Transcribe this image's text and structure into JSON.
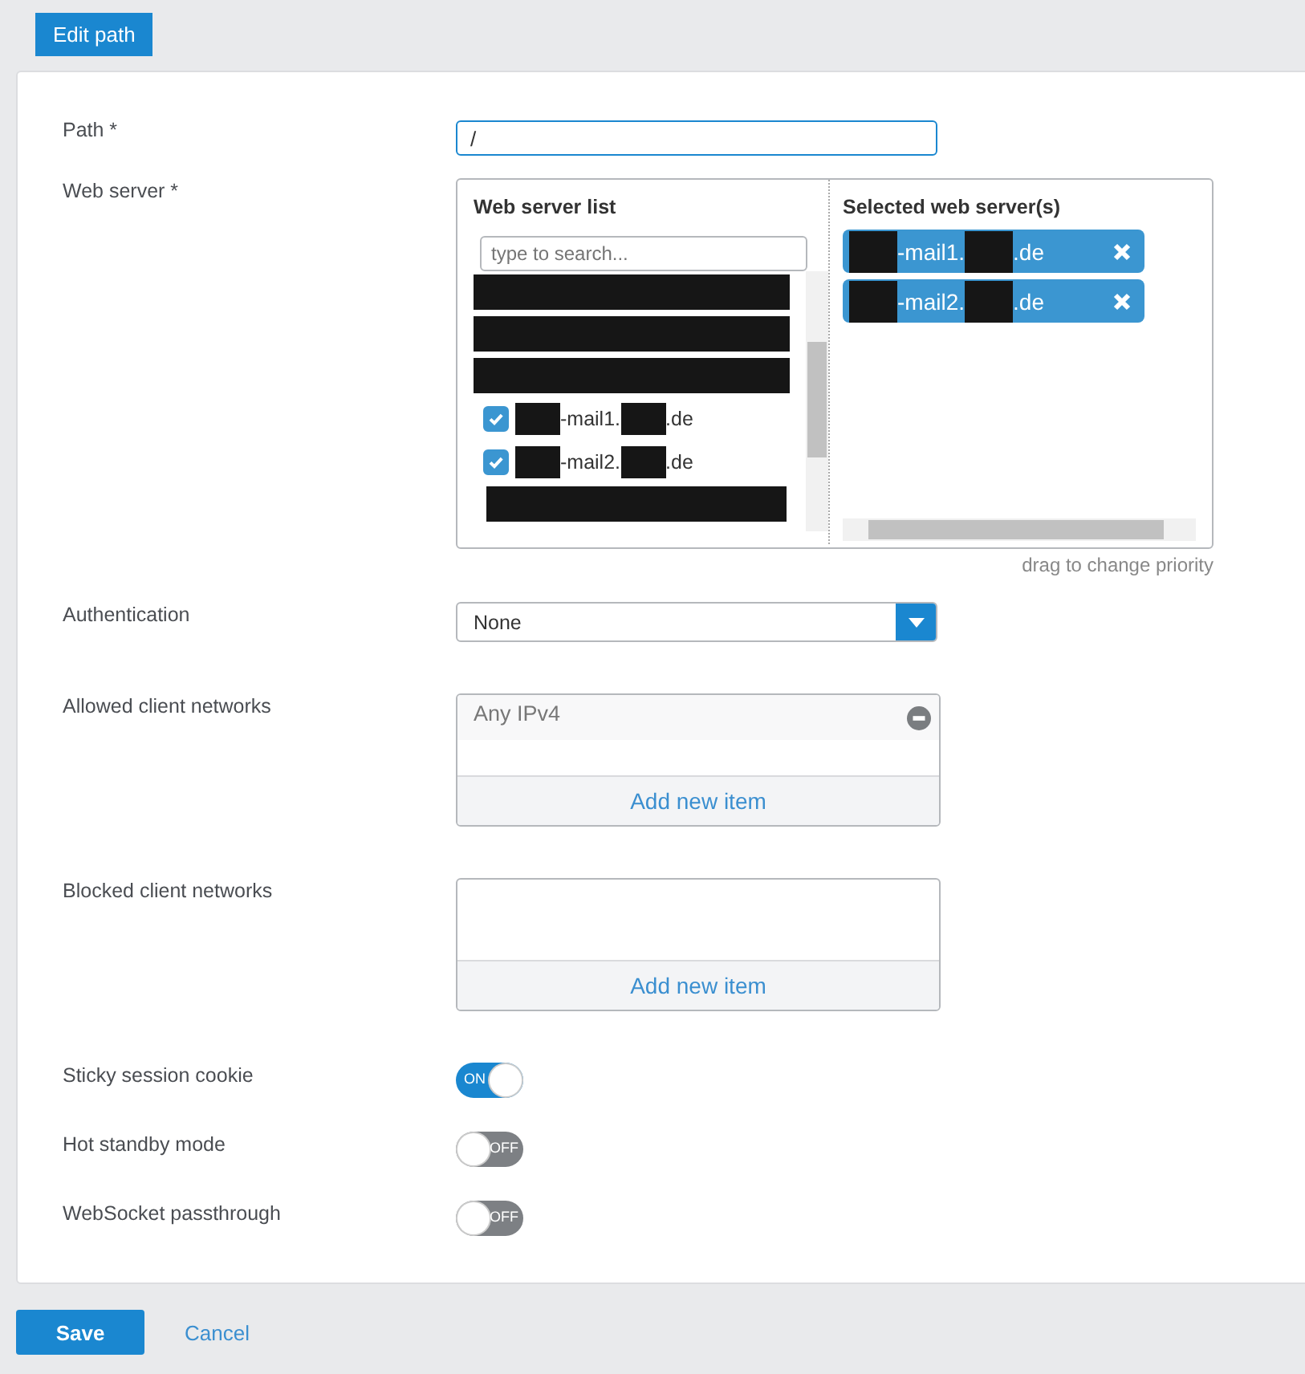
{
  "header_button": "Edit path",
  "path": {
    "label": "Path *",
    "value": "/"
  },
  "web_server": {
    "label": "Web server *",
    "list_title": "Web server list",
    "search_placeholder": "type to search...",
    "selected_title": "Selected web server(s)",
    "hint": "drag to change priority",
    "items": [
      {
        "kind": "redaction"
      },
      {
        "kind": "redaction"
      },
      {
        "kind": "redaction"
      },
      {
        "kind": "server",
        "checked": true,
        "segments": [
          {
            "kind": "redaction"
          },
          {
            "kind": "text",
            "text": "-mail1."
          },
          {
            "kind": "redaction"
          },
          {
            "kind": "text",
            "text": ".de"
          }
        ]
      },
      {
        "kind": "server",
        "checked": true,
        "segments": [
          {
            "kind": "redaction"
          },
          {
            "kind": "text",
            "text": "-mail2."
          },
          {
            "kind": "redaction"
          },
          {
            "kind": "text",
            "text": ".de"
          }
        ]
      },
      {
        "kind": "redaction"
      }
    ],
    "selected": [
      {
        "segments": [
          {
            "kind": "redaction"
          },
          {
            "kind": "text",
            "text": "-mail1."
          },
          {
            "kind": "redaction"
          },
          {
            "kind": "text",
            "text": ".de"
          }
        ]
      },
      {
        "segments": [
          {
            "kind": "redaction"
          },
          {
            "kind": "text",
            "text": "-mail2."
          },
          {
            "kind": "redaction"
          },
          {
            "kind": "text",
            "text": ".de"
          }
        ]
      }
    ]
  },
  "authentication": {
    "label": "Authentication",
    "value": "None"
  },
  "allowed_networks": {
    "label": "Allowed client networks",
    "items": [
      "Any IPv4"
    ],
    "add": "Add new item"
  },
  "blocked_networks": {
    "label": "Blocked client networks",
    "add": "Add new item"
  },
  "toggles": [
    {
      "label": "Sticky session cookie",
      "on": true,
      "text": "ON"
    },
    {
      "label": "Hot standby mode",
      "on": false,
      "text": "OFF"
    },
    {
      "label": "WebSocket passthrough",
      "on": false,
      "text": "OFF"
    }
  ],
  "buttons": {
    "save": "Save",
    "cancel": "Cancel"
  }
}
